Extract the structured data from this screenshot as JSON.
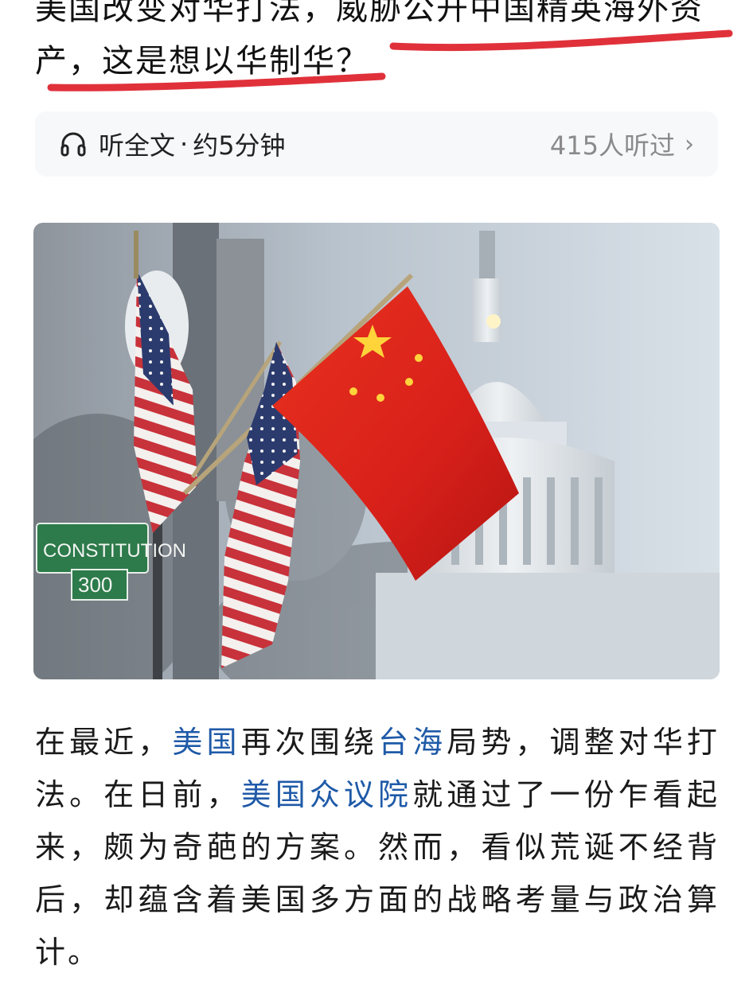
{
  "article": {
    "title_line1": "美国改变对华打法，威胁公开中国精英海外资",
    "title_line2": "产，这是想以华制华？",
    "highlight_color": "#e0313b"
  },
  "listen": {
    "icon": "headphones-icon",
    "label": "听全文",
    "separator": "·",
    "duration": "约5分钟",
    "listeners": "415人听过",
    "chevron": "›"
  },
  "hero_image": {
    "description_icon": "flags-photo",
    "sign_street": "CONSTITUTION",
    "sign_suffix": "N",
    "sign_number": "300"
  },
  "body": {
    "p1_a": "在最近，",
    "p1_link1": "美国",
    "p1_b": "再次围绕",
    "p1_link2": "台海",
    "p1_c": "局势，调整对华打法。在日前，",
    "p1_link3": "美国众议院",
    "p1_d": "就通过了一份乍看起来，颇为奇葩的方案。然而，看似荒诞不经背后，却蕴含着美国多方面的战略考量与政治算计。",
    "link_color": "#1f5aa8"
  }
}
